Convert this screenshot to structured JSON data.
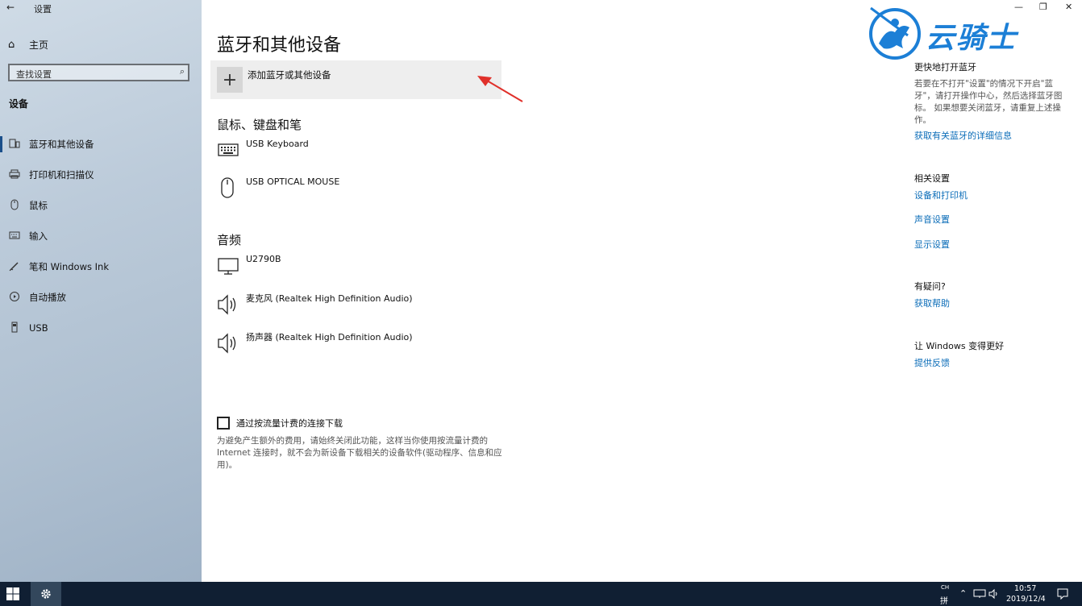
{
  "window": {
    "title": "设置",
    "back_icon": "←",
    "min_icon": "—",
    "restore_icon": "❐",
    "close_icon": "✕"
  },
  "sidebar": {
    "home_label": "主页",
    "search_placeholder": "查找设置",
    "section_title": "设备",
    "items": [
      {
        "label": "蓝牙和其他设备",
        "icon": "bluetooth-devices-icon",
        "active": true
      },
      {
        "label": "打印机和扫描仪",
        "icon": "printer-icon",
        "active": false
      },
      {
        "label": "鼠标",
        "icon": "mouse-icon",
        "active": false
      },
      {
        "label": "输入",
        "icon": "keyboard-icon",
        "active": false
      },
      {
        "label": "笔和 Windows Ink",
        "icon": "pen-icon",
        "active": false
      },
      {
        "label": "自动播放",
        "icon": "autoplay-icon",
        "active": false
      },
      {
        "label": "USB",
        "icon": "usb-icon",
        "active": false
      }
    ]
  },
  "main": {
    "title": "蓝牙和其他设备",
    "add_device_label": "添加蓝牙或其他设备",
    "groups": [
      {
        "title": "鼠标、键盘和笔",
        "devices": [
          {
            "name": "USB Keyboard",
            "icon": "keyboard-icon"
          },
          {
            "name": "USB OPTICAL MOUSE",
            "icon": "mouse-icon"
          }
        ]
      },
      {
        "title": "音频",
        "devices": [
          {
            "name": "U2790B",
            "icon": "monitor-icon"
          },
          {
            "name": "麦克风 (Realtek High Definition Audio)",
            "icon": "speaker-icon"
          },
          {
            "name": "扬声器 (Realtek High Definition Audio)",
            "icon": "speaker-icon"
          }
        ]
      }
    ],
    "metered_label": "通过按流量计费的连接下载",
    "metered_checked": false,
    "metered_desc": "为避免产生额外的费用，请始终关闭此功能，这样当你使用按流量计费的 Internet 连接时，就不会为新设备下载相关的设备软件(驱动程序、信息和应用)。"
  },
  "right": {
    "faster_heading": "更快地打开蓝牙",
    "faster_text": "若要在不打开\"设置\"的情况下开启\"蓝牙\"，请打开操作中心，然后选择蓝牙图标。 如果想要关闭蓝牙，请重复上述操作。",
    "bt_info_link": "获取有关蓝牙的详细信息",
    "related_heading": "相关设置",
    "related_links": [
      "设备和打印机",
      "声音设置",
      "显示设置"
    ],
    "question_heading": "有疑问?",
    "help_link": "获取帮助",
    "better_heading": "让 Windows 变得更好",
    "feedback_link": "提供反馈"
  },
  "logo": {
    "text": "云骑士"
  },
  "taskbar": {
    "ime_top": "CH",
    "ime_bottom": "拼",
    "time": "10:57",
    "date": "2019/12/4"
  },
  "colors": {
    "accent": "#0a6cb8",
    "taskbar": "#101f33",
    "logo": "#1c7fd6"
  }
}
